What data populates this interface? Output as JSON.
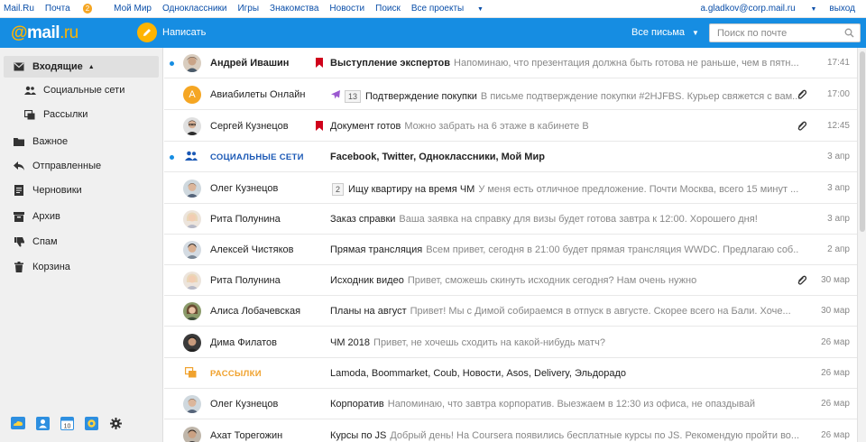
{
  "topbar": {
    "links": [
      "Mail.Ru",
      "Почта",
      "Мой Мир",
      "Одноклассники",
      "Игры",
      "Знакомства",
      "Новости",
      "Поиск",
      "Все проекты"
    ],
    "mail_badge": "2",
    "account": "a.gladkov@corp.mail.ru",
    "logout": "выход"
  },
  "header": {
    "logo_at": "@",
    "logo_mail": "mail",
    "logo_ru": ".ru",
    "compose_label": "Написать",
    "filter_label": "Все письма",
    "search_placeholder": "Поиск по почте"
  },
  "sidebar": {
    "folders": [
      {
        "label": "Входящие",
        "icon": "inbox-icon"
      },
      {
        "label": "Социальные сети",
        "icon": "people-icon"
      },
      {
        "label": "Рассылки",
        "icon": "newsletter-icon"
      },
      {
        "label": "Важное",
        "icon": "folder-icon"
      },
      {
        "label": "Отправленные",
        "icon": "reply-icon"
      },
      {
        "label": "Черновики",
        "icon": "draft-icon"
      },
      {
        "label": "Архив",
        "icon": "archive-icon"
      },
      {
        "label": "Спам",
        "icon": "thumbs-down-icon"
      },
      {
        "label": "Корзина",
        "icon": "trash-icon"
      }
    ],
    "bottom_icons": [
      "cloud-icon",
      "contacts-icon",
      "calendar-icon",
      "gear-sun-icon",
      "settings-icon"
    ],
    "calendar_day": "10"
  },
  "messages": [
    {
      "sender": "Андрей Ивашин",
      "flag": true,
      "subject": "Выступление экспертов",
      "snippet": "Напоминаю, что презентация должна быть готова не раньше, чем в пятн...",
      "date": "17:41",
      "unread": true,
      "attach": false
    },
    {
      "sender": "Авиабилеты Онлайн",
      "avatar_letter": "A",
      "plane": true,
      "counter": "13",
      "subject": "Подтверждение покупки",
      "snippet": "В письме подтверждение покупки #2HJFBS. Курьер свяжется с вам...",
      "date": "17:00",
      "unread": false,
      "attach": true
    },
    {
      "sender": "Сергей Кузнецов",
      "flag": true,
      "subject": "Документ готов",
      "snippet": "Можно забрать на 6 этаже в кабинете В",
      "date": "12:45",
      "unread": false,
      "attach": true
    },
    {
      "group_label": "СОЦИАЛЬНЫЕ СЕТИ",
      "group_color": "#1a58b5",
      "subject": "Facebook, Twitter, Одноклассники, Мой Мир",
      "snippet": "",
      "date": "3 апр",
      "unread": true,
      "attach": false
    },
    {
      "sender": "Олег Кузнецов",
      "counter": "2",
      "subject": "Ищу квартиру на время ЧМ",
      "snippet": "У меня есть отличное предложение. Почти Москва, всего 15 минут ...",
      "date": "3 апр",
      "unread": false,
      "attach": false
    },
    {
      "sender": "Рита Полунина",
      "subject": "Заказ справки",
      "snippet": "Ваша заявка на справку для визы будет готова завтра к 12:00. Хорошего дня!",
      "date": "3 апр",
      "unread": false,
      "attach": false
    },
    {
      "sender": "Алексей Чистяков",
      "subject": "Прямая трансляция",
      "snippet": "Всем привет, сегодня в 21:00 будет прямая трансляция WWDC. Предлагаю соб...",
      "date": "2 апр",
      "unread": false,
      "attach": false
    },
    {
      "sender": "Рита Полунина",
      "subject": "Исходник видео",
      "snippet": "Привет, сможешь скинуть исходник сегодня? Нам очень нужно",
      "date": "30 мар",
      "unread": false,
      "attach": true
    },
    {
      "sender": "Алиса Лобачевская",
      "subject": "Планы на август",
      "snippet": "Привет! Мы с Димой собираемся в отпуск в августе. Скорее всего на Бали. Хоче...",
      "date": "30 мар",
      "unread": false,
      "attach": false
    },
    {
      "sender": "Дима Филатов",
      "subject": "ЧМ 2018",
      "snippet": "Привет, не хочешь сходить на какой-нибудь матч?",
      "date": "26 мар",
      "unread": false,
      "attach": false
    },
    {
      "group_label": "РАССЫЛКИ",
      "group_color": "#f0a22e",
      "subject": "Lamoda, Boommarket, Coub, Новости, Asos, Delivery, Эльдорадо",
      "snippet": "",
      "date": "26 мар",
      "unread": false,
      "attach": false
    },
    {
      "sender": "Олег Кузнецов",
      "subject": "Корпоратив",
      "snippet": "Напоминаю, что завтра корпоратив. Выезжаем в 12:30 из офиса, не опаздывай",
      "date": "26 мар",
      "unread": false,
      "attach": false
    },
    {
      "sender": "Ахат Торегожин",
      "subject": "Курсы по JS",
      "snippet": "Добрый день! На Coursera появились бесплатные курсы по JS. Рекомендую пройти во...",
      "date": "26 мар",
      "unread": false,
      "attach": false
    }
  ],
  "colors": {
    "accent": "#168de2",
    "logo_accent": "#ffb400",
    "flag": "#d0021b",
    "link": "#0a4ea8"
  }
}
